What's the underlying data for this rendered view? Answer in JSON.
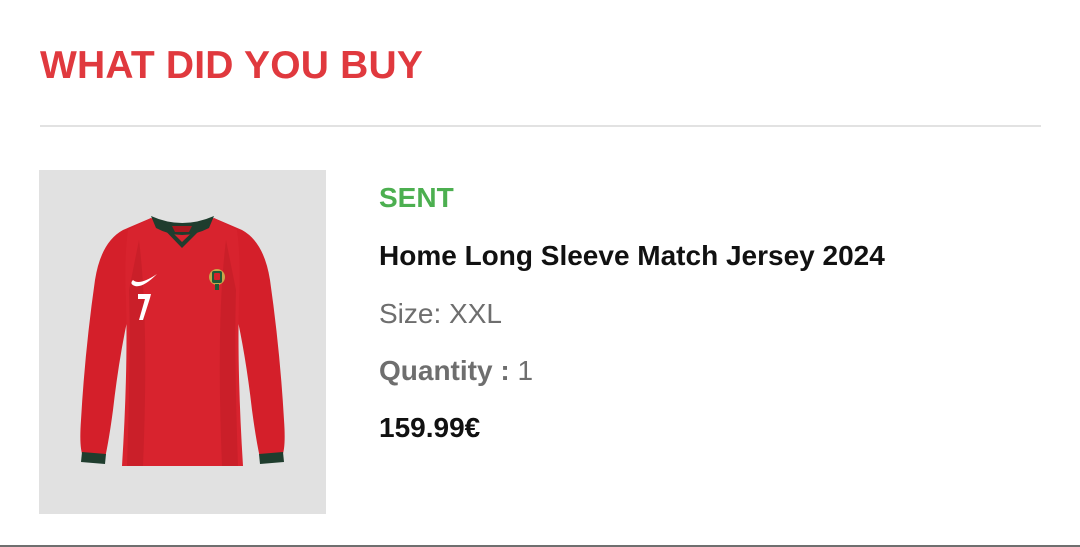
{
  "section": {
    "title": "WHAT DID YOU BUY"
  },
  "item": {
    "image_alt": "Home Long Sleeve Match Jersey 2024",
    "status": "SENT",
    "name": "Home Long Sleeve Match Jersey 2024",
    "size_text": "Size: XXL",
    "quantity_label": "Quantity",
    "quantity_separator": " : ",
    "quantity_value": "1",
    "price": "159.99€"
  },
  "colors": {
    "title": "#e0393e",
    "status": "#4caf50",
    "muted_text": "#6e6e6e",
    "primary_text": "#111111",
    "image_background": "#e1e1e1",
    "jersey_red": "#d41f2a",
    "jersey_trim": "#1f3d2e"
  },
  "icons": {
    "product": "red-jersey-icon",
    "brand": "swoosh-icon",
    "crest": "crest-icon"
  }
}
